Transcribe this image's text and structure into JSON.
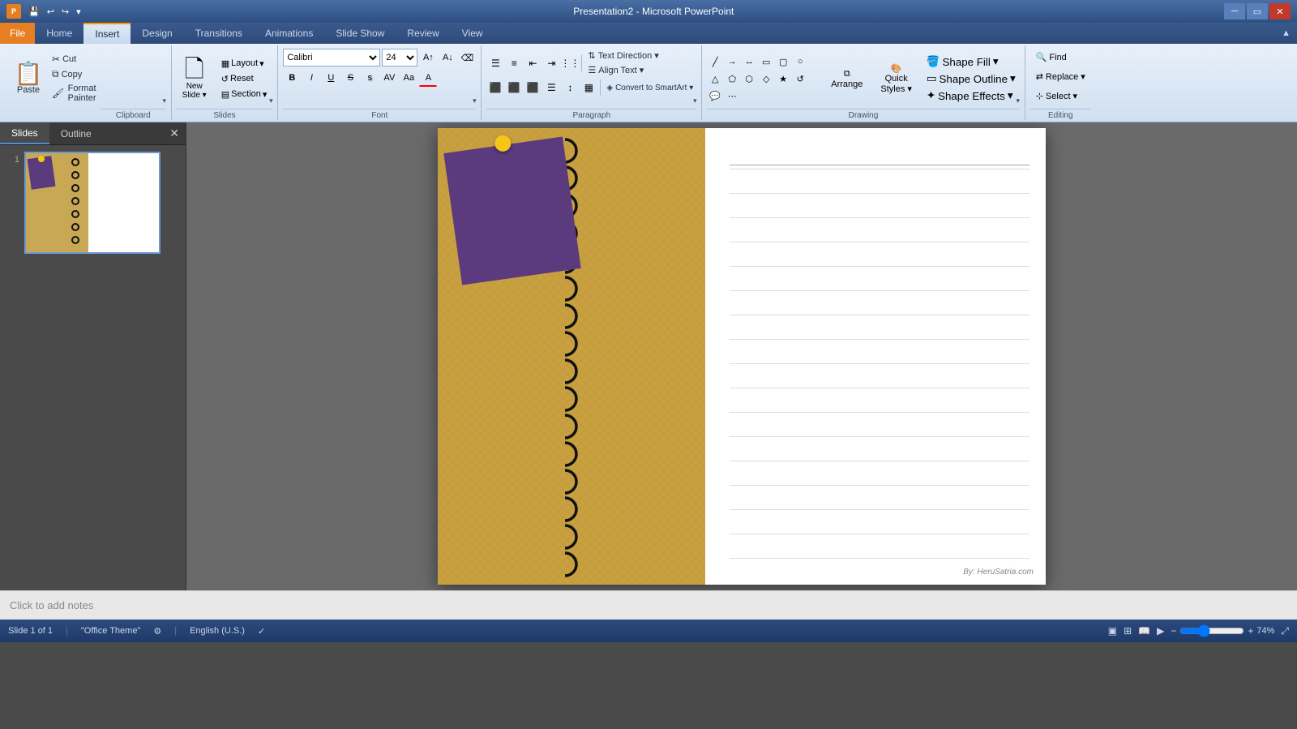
{
  "titlebar": {
    "title": "Presentation2 - Microsoft PowerPoint",
    "icon_label": "P",
    "quick_access": [
      "save",
      "undo",
      "redo",
      "customize"
    ],
    "win_controls": [
      "minimize",
      "restore",
      "close"
    ]
  },
  "ribbon": {
    "tabs": [
      "File",
      "Home",
      "Insert",
      "Design",
      "Transitions",
      "Animations",
      "Slide Show",
      "Review",
      "View"
    ],
    "active_tab": "Insert",
    "groups": {
      "clipboard": {
        "label": "Clipboard",
        "paste": "Paste",
        "cut": "Cut",
        "copy": "Copy",
        "format_painter": "Format Painter"
      },
      "slides": {
        "label": "Slides",
        "new_slide": "New Slide",
        "layout": "Layout",
        "reset": "Reset",
        "section": "Section"
      },
      "font": {
        "label": "Font",
        "font_name": "Calibri",
        "font_size": "24",
        "bold": "B",
        "italic": "I",
        "underline": "U",
        "strikethrough": "S",
        "shadow": "s",
        "char_spacing": "AV"
      },
      "paragraph": {
        "label": "Paragraph",
        "text_direction": "Text Direction",
        "align_text": "Align Text",
        "convert_smartart": "Convert to SmartArt"
      },
      "drawing": {
        "label": "Drawing",
        "arrange": "Arrange",
        "quick_styles": "Quick Styles",
        "shape_fill": "Shape Fill",
        "shape_outline": "Shape Outline",
        "shape_effects": "Shape Effects"
      },
      "editing": {
        "label": "Editing",
        "find": "Find",
        "replace": "Replace",
        "select": "Select"
      }
    }
  },
  "slide_panel": {
    "tabs": [
      "Slides",
      "Outline"
    ],
    "slides": [
      {
        "number": 1
      }
    ]
  },
  "slide": {
    "watermark": "By: HeruSatria.com"
  },
  "notes": {
    "placeholder": "Click to add notes"
  },
  "statusbar": {
    "slide_info": "Slide 1 of 1",
    "theme": "\"Office Theme\"",
    "language": "English (U.S.)",
    "zoom": "74%"
  }
}
